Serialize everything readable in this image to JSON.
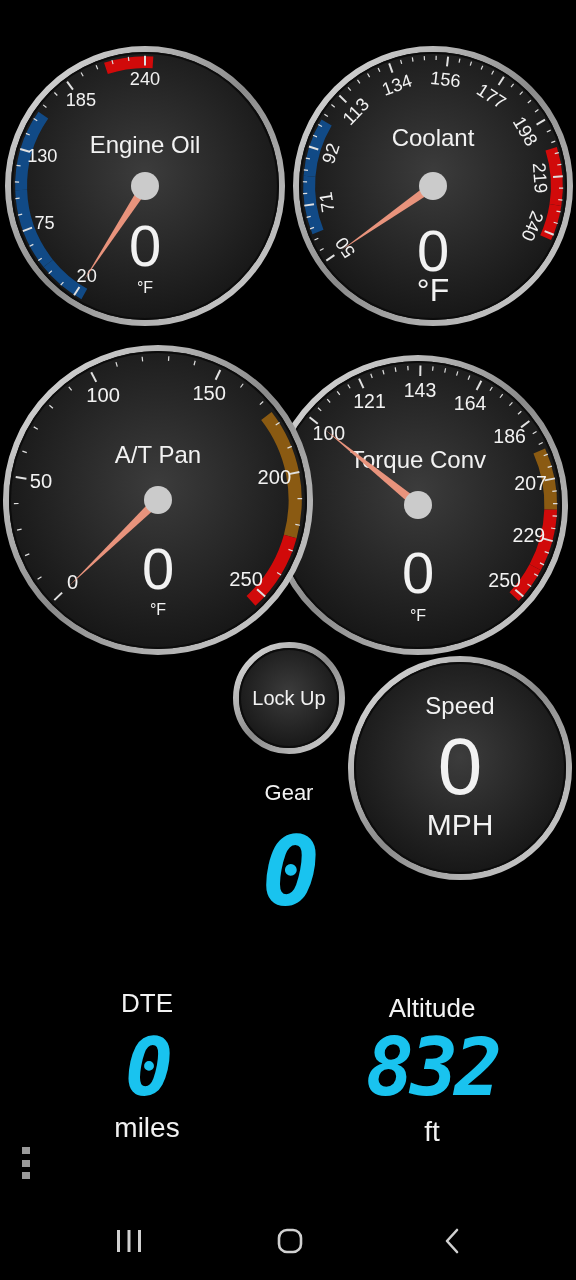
{
  "gauges": [
    {
      "title": "Engine Oil",
      "value": "0",
      "unit": "°F",
      "ticks": [
        {
          "label": "20",
          "color": "#114a86"
        },
        {
          "label": "75",
          "color": "#114a86"
        },
        {
          "label": "130",
          "color": "#114a86"
        },
        {
          "label": "185"
        },
        {
          "label": "240",
          "color": "#d10a0a"
        }
      ]
    },
    {
      "title": "Coolant",
      "value": "0",
      "unit": "°F",
      "ticks": [
        {
          "label": "50"
        },
        {
          "label": "71",
          "color": "#114a86"
        },
        {
          "label": "92",
          "color": "#114a86"
        },
        {
          "label": "113"
        },
        {
          "label": "134"
        },
        {
          "label": "156"
        },
        {
          "label": "177"
        },
        {
          "label": "198"
        },
        {
          "label": "219",
          "color": "#d10a0a"
        },
        {
          "label": "240",
          "color": "#d10a0a"
        }
      ]
    },
    {
      "title": "A/T Pan",
      "value": "0",
      "unit": "°F",
      "ticks": [
        {
          "label": "0"
        },
        {
          "label": "50"
        },
        {
          "label": "100"
        },
        {
          "label": "150"
        },
        {
          "label": "200",
          "color": "#8a5a12"
        },
        {
          "label": "250",
          "color": "#d10a0a"
        }
      ]
    },
    {
      "title": "Torque Conv",
      "value": "0",
      "unit": "°F",
      "ticks": [
        {
          "label": "100"
        },
        {
          "label": "121"
        },
        {
          "label": "143"
        },
        {
          "label": "164"
        },
        {
          "label": "186"
        },
        {
          "label": "207",
          "color": "#8a5a12"
        },
        {
          "label": "229",
          "color": "#d10a0a"
        },
        {
          "label": "250",
          "color": "#d10a0a"
        }
      ]
    }
  ],
  "lock_up": {
    "label": "Lock Up"
  },
  "speed": {
    "title": "Speed",
    "value": "0",
    "unit": "MPH"
  },
  "readouts": [
    {
      "label": "Gear",
      "value": "0"
    },
    {
      "label": "DTE",
      "value": "0",
      "unit": "miles"
    },
    {
      "label": "Altitude",
      "value": "832",
      "unit": "ft"
    }
  ]
}
